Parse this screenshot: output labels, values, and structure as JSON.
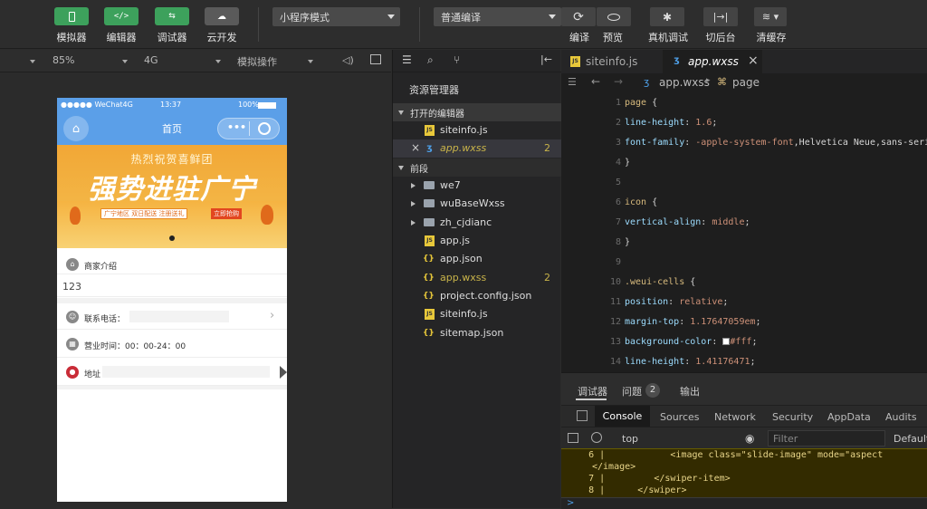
{
  "toolbar": {
    "buttons": [
      {
        "label": "模拟器",
        "icon": "phone-icon"
      },
      {
        "label": "编辑器",
        "icon": "code-icon"
      },
      {
        "label": "调试器",
        "icon": "debug-icon"
      },
      {
        "label": "云开发",
        "icon": "cloud-icon"
      }
    ],
    "mode_select": "小程序模式",
    "compile_select": "普通编译",
    "right_buttons": [
      {
        "label": "编译",
        "icon": "refresh-icon"
      },
      {
        "label": "预览",
        "icon": "eye-icon"
      },
      {
        "label": "真机调试",
        "icon": "bug-icon"
      },
      {
        "label": "切后台",
        "icon": "switch-icon"
      },
      {
        "label": "清缓存",
        "icon": "layers-icon"
      }
    ]
  },
  "subbar": {
    "zoom": "85%",
    "network": "4G",
    "simulate": "模拟操作"
  },
  "phone": {
    "status_carrier": "●●●●● WeChat4G",
    "status_time": "13:37",
    "status_battery": "100%",
    "nav_title": "首页",
    "banner_top": "热烈祝贺喜鲜团",
    "banner_main": "强势进驻广宁",
    "banner_tags": [
      "广宁地区",
      "双日配送",
      "注册送礼"
    ],
    "banner_button": "立即抢购",
    "merchant_label": "商家介绍",
    "merchant_value": "123",
    "phone_label": "联系电话：",
    "hours_label": "营业时间：00：00-24：00",
    "address_label": "地址"
  },
  "explorer": {
    "title": "资源管理器",
    "open_editors": "打开的编辑器",
    "open_files": [
      {
        "name": "siteinfo.js",
        "type": "js",
        "badge": ""
      },
      {
        "name": "app.wxss",
        "type": "wxss",
        "badge": "2"
      }
    ],
    "project": "前段",
    "tree": [
      {
        "name": "we7",
        "type": "folder",
        "badge": ""
      },
      {
        "name": "wuBaseWxss",
        "type": "folder",
        "badge": ""
      },
      {
        "name": "zh_cjdianc",
        "type": "folder",
        "badge": ""
      },
      {
        "name": "app.js",
        "type": "js",
        "badge": ""
      },
      {
        "name": "app.json",
        "type": "json",
        "badge": ""
      },
      {
        "name": "app.wxss",
        "type": "wxss",
        "badge": "2"
      },
      {
        "name": "project.config.json",
        "type": "json",
        "badge": ""
      },
      {
        "name": "siteinfo.js",
        "type": "js",
        "badge": ""
      },
      {
        "name": "sitemap.json",
        "type": "json",
        "badge": ""
      }
    ]
  },
  "editor": {
    "tabs": [
      "siteinfo.js",
      "app.wxss"
    ],
    "breadcrumb_file": "app.wxss",
    "breadcrumb_symbol": "page",
    "lines": [
      {
        "n": "1",
        "html": "<span class=\"sel\">page</span> <span class=\"br\">{</span>"
      },
      {
        "n": "2",
        "html": "    <span class=\"prop\">line-height</span>: <span class=\"val\">1.6</span>;"
      },
      {
        "n": "3",
        "html": "    <span class=\"prop\">font-family</span>: <span class=\"val\">-apple-system-font</span>,Helvetica Neue,sans-serif;"
      },
      {
        "n": "4",
        "html": "<span class=\"br\">}</span>"
      },
      {
        "n": "5",
        "html": ""
      },
      {
        "n": "6",
        "html": "<span class=\"sel\">icon</span> <span class=\"br\">{</span>"
      },
      {
        "n": "7",
        "html": "    <span class=\"prop\">vertical-align</span>: <span class=\"val\">middle</span>;"
      },
      {
        "n": "8",
        "html": "<span class=\"br\">}</span>"
      },
      {
        "n": "9",
        "html": ""
      },
      {
        "n": "10",
        "html": "<span class=\"cls\">.weui-cells</span> <span class=\"br\">{</span>"
      },
      {
        "n": "11",
        "html": "    <span class=\"prop\">position</span>: <span class=\"val\">relative</span>;"
      },
      {
        "n": "12",
        "html": "    <span class=\"prop\">margin-top</span>: <span class=\"val\">1.17647059em</span>;"
      },
      {
        "n": "13",
        "html": "    <span class=\"prop\">background-color</span>: <span style=\"display:inline-block;width:8px;height:8px;background:#fff;border:1px solid #888;vertical-align:middle\"></span><span class=\"val\">#fff</span>;"
      },
      {
        "n": "14",
        "html": "    <span class=\"prop\">line-height</span>: <span class=\"val\">1.41176471</span>;"
      }
    ]
  },
  "debugger": {
    "tabs": [
      "调试器",
      "问题",
      "输出"
    ],
    "problem_count": "2",
    "devtools_tabs": [
      "Console",
      "Sources",
      "Network",
      "Security",
      "AppData",
      "Audits"
    ],
    "context": "top",
    "filter_placeholder": "Filter",
    "level": "Default",
    "console_lines": [
      "     6 |            <image class=\"slide-image\" mode=\"aspect",
      "</image>",
      "     7 |         </swiper-item>",
      "     8 |      </swiper>"
    ],
    "prompt": ">"
  }
}
